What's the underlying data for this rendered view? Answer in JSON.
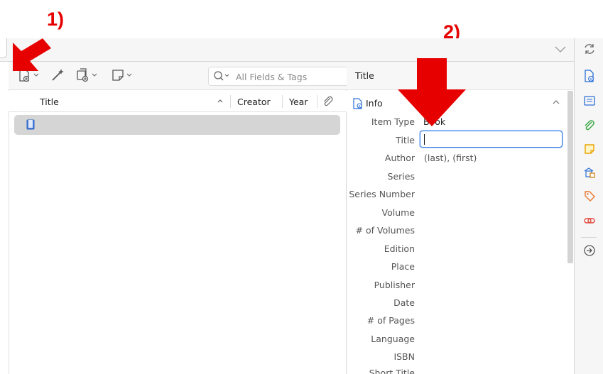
{
  "annotations": {
    "step1": "1)",
    "step2": "2)"
  },
  "toolbar": {
    "new_item_icon": "new-item-icon",
    "add_by_identifier_icon": "magic-wand-icon",
    "new_attachment_icon": "attachment-add-icon",
    "new_note_icon": "note-add-icon",
    "search_placeholder": "All Fields & Tags"
  },
  "items_table": {
    "columns": [
      "Title",
      "Creator",
      "Year"
    ],
    "sorted_column": "Title",
    "rows": [
      {
        "type_icon": "book-icon",
        "title": ""
      }
    ]
  },
  "item_pane": {
    "header_title": "Title",
    "section_title": "Info",
    "fields": [
      {
        "label": "Item Type",
        "value": "Book"
      },
      {
        "label": "Title",
        "value": ""
      },
      {
        "label": "Author",
        "value": "(last), (first)"
      },
      {
        "label": "Series",
        "value": ""
      },
      {
        "label": "Series Number",
        "value": ""
      },
      {
        "label": "Volume",
        "value": ""
      },
      {
        "label": "# of Volumes",
        "value": ""
      },
      {
        "label": "Edition",
        "value": ""
      },
      {
        "label": "Place",
        "value": ""
      },
      {
        "label": "Publisher",
        "value": ""
      },
      {
        "label": "Date",
        "value": ""
      },
      {
        "label": "# of Pages",
        "value": ""
      },
      {
        "label": "Language",
        "value": ""
      },
      {
        "label": "ISBN",
        "value": ""
      },
      {
        "label": "Short Title",
        "value": ""
      }
    ]
  },
  "side_nav": [
    "sync-icon",
    "info-icon",
    "abstract-icon",
    "attachments-icon",
    "notes-icon",
    "libraries-icon",
    "tags-icon",
    "related-icon",
    "locate-icon"
  ],
  "colors": {
    "accent": "#3b7ee5",
    "annotation_red": "#e60000",
    "selection": "#d5d5d5"
  }
}
